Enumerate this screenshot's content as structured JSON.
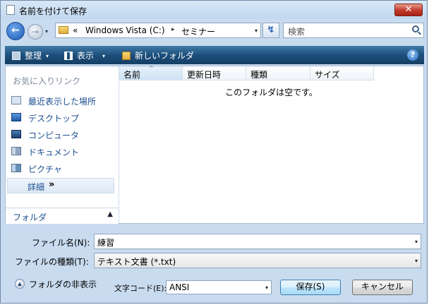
{
  "window": {
    "title": "名前を付けて保存",
    "close_glyph": "✕"
  },
  "nav": {
    "back_glyph": "←",
    "forward_glyph": "→",
    "recent_glyph": "▾",
    "address": {
      "overflow": "«",
      "segments": [
        "Windows Vista (C:)",
        "セミナー"
      ],
      "separator": "▸",
      "drop": "▾"
    },
    "refresh_glyph": "↯",
    "search_placeholder": "検索"
  },
  "toolbar": {
    "organize": "整理",
    "views": "表示",
    "new_folder": "新しいフォルダ",
    "drop": "▾",
    "help": "?"
  },
  "navpane": {
    "header": "お気に入りリンク",
    "items": [
      {
        "label": "最近表示した場所",
        "icon": "recent-places-icon"
      },
      {
        "label": "デスクトップ",
        "icon": "desktop-icon"
      },
      {
        "label": "コンピュータ",
        "icon": "computer-icon"
      },
      {
        "label": "ドキュメント",
        "icon": "documents-icon"
      },
      {
        "label": "ピクチャ",
        "icon": "pictures-icon"
      }
    ],
    "details": "詳細",
    "details_chevron": "»",
    "folders": "フォルダ",
    "folders_chevron": "▲"
  },
  "list": {
    "columns": [
      "名前",
      "更新日時",
      "種類",
      "サイズ"
    ],
    "sort_glyph": "^",
    "empty_message": "このフォルダは空です。"
  },
  "form": {
    "filename_label": "ファイル名(N):",
    "filename_value": "練習",
    "filetype_label": "ファイルの種類(T):",
    "filetype_value": "テキスト文書 (*.txt)",
    "drop": "▾",
    "hide_folders_label": "フォルダの非表示",
    "hide_glyph": "▲",
    "encoding_label": "文字コード(E):",
    "encoding_value": "ANSI",
    "save_button": "保存(S)",
    "cancel_button": "キャンセル"
  }
}
